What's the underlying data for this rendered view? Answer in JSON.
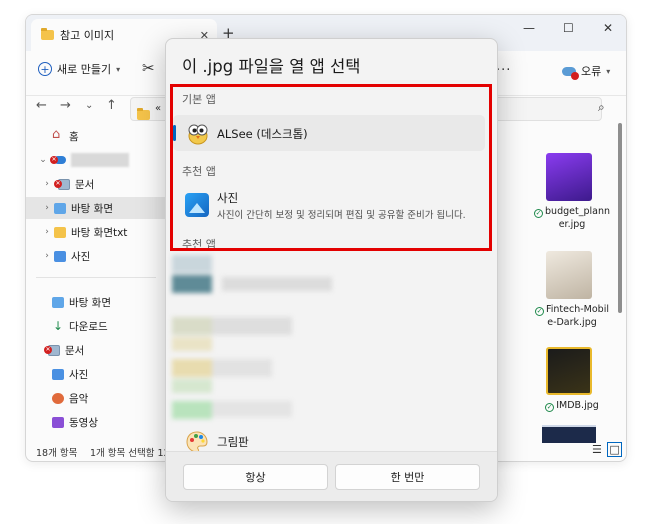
{
  "explorer": {
    "tab_title": "참고 이미지",
    "tab_close": "✕",
    "tab_add": "+",
    "win_min": "—",
    "win_max": "☐",
    "win_close": "✕",
    "new_button": "새로 만들기",
    "error_button": "오류",
    "address_text": "«  b",
    "sidebar": {
      "home": "홈",
      "documents": "문서",
      "desktop": "바탕 화면",
      "desktop_txt": "바탕 화면txt",
      "photos": "사진",
      "q_desktop": "바탕 화면",
      "q_downloads": "다운로드",
      "q_documents": "문서",
      "q_photos": "사진",
      "q_music": "음악",
      "q_videos": "동영상"
    },
    "status_count": "18개 항목",
    "status_selected": "1개 항목 선택함 12",
    "files": [
      {
        "name": "budget_planner.jpg",
        "line1": "budget_plann",
        "line2": "er.jpg",
        "thumb_color": "#6a2bd1"
      },
      {
        "name": "Fintech-Mobile-Dark.jpg",
        "line1": "Fintech-Mobil",
        "line2": "e-Dark.jpg",
        "thumb_color": "#d8cfc0"
      },
      {
        "name": "IMDB.jpg",
        "line1": "IMDB.jpg",
        "line2": "",
        "thumb_color": "#e9b92c"
      }
    ]
  },
  "dialog": {
    "title": "이 .jpg 파일을 열 앱 선택",
    "default_section": "기본 앱",
    "default_app": "ALSee (데스크톱)",
    "recommended_section": "추천 앱",
    "rec_app_name": "사진",
    "rec_app_desc": "사진이 간단히 보정 및 정리되며 편집 및 공유할 준비가 됩니다.",
    "recommended_section2": "추천 앱",
    "paint_app": "그림판",
    "always_button": "항상",
    "once_button": "한 번만"
  },
  "colors": {
    "highlight": "#e30000",
    "accent": "#0067c0"
  }
}
